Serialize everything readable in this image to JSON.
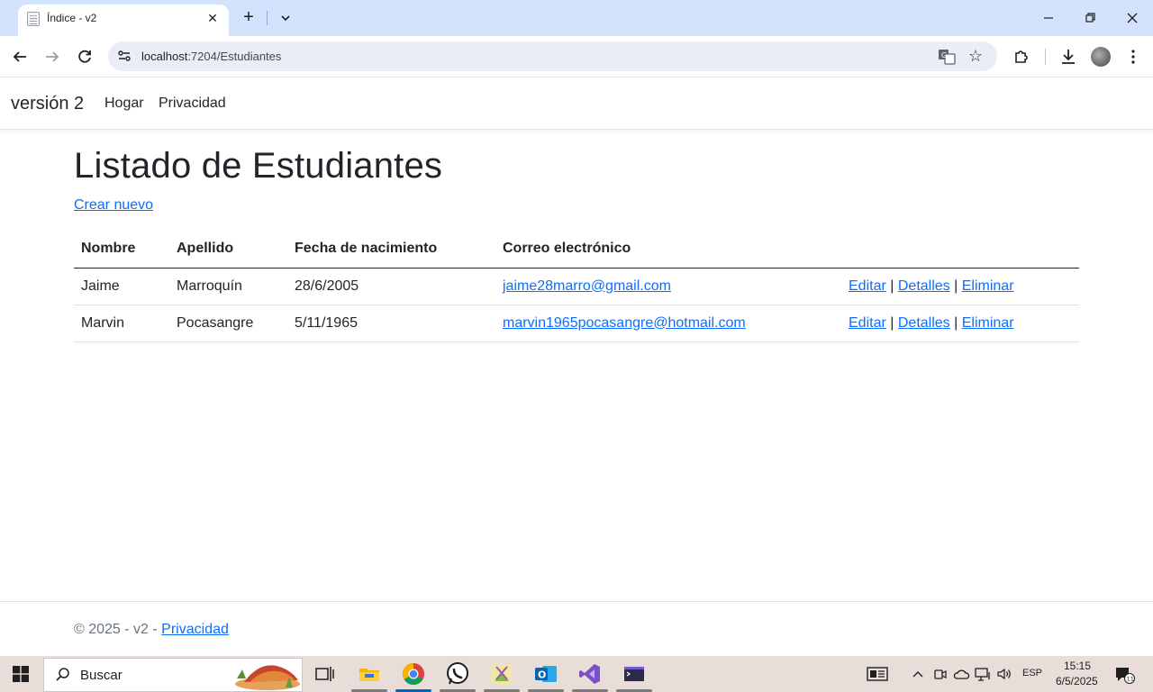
{
  "browser": {
    "tab_title": "Índice - v2",
    "url_host": "localhost",
    "url_rest": ":7204/Estudiantes"
  },
  "navbar": {
    "brand": "versión 2",
    "links": [
      "Hogar",
      "Privacidad"
    ]
  },
  "main": {
    "title": "Listado de Estudiantes",
    "create_link": "Crear nuevo",
    "table": {
      "headers": [
        "Nombre",
        "Apellido",
        "Fecha de nacimiento",
        "Correo electrónico"
      ],
      "rows": [
        {
          "nombre": "Jaime",
          "apellido": "Marroquín",
          "fecha": "28/6/2005",
          "correo": "jaime28marro@gmail.com"
        },
        {
          "nombre": "Marvin",
          "apellido": "Pocasangre",
          "fecha": "5/11/1965",
          "correo": "marvin1965pocasangre@hotmail.com"
        }
      ],
      "actions": {
        "edit": "Editar",
        "details": "Detalles",
        "delete": "Eliminar",
        "separator": "|"
      }
    }
  },
  "footer": {
    "text": "© 2025 - v2 - ",
    "link": "Privacidad"
  },
  "taskbar": {
    "search_placeholder": "Buscar",
    "language": "ESP",
    "time": "15:15",
    "date": "6/5/2025",
    "notification_count": "11"
  },
  "colors": {
    "link": "#0d6efd",
    "tabstrip": "#d3e3fd",
    "taskbar": "#e8ddd8"
  }
}
